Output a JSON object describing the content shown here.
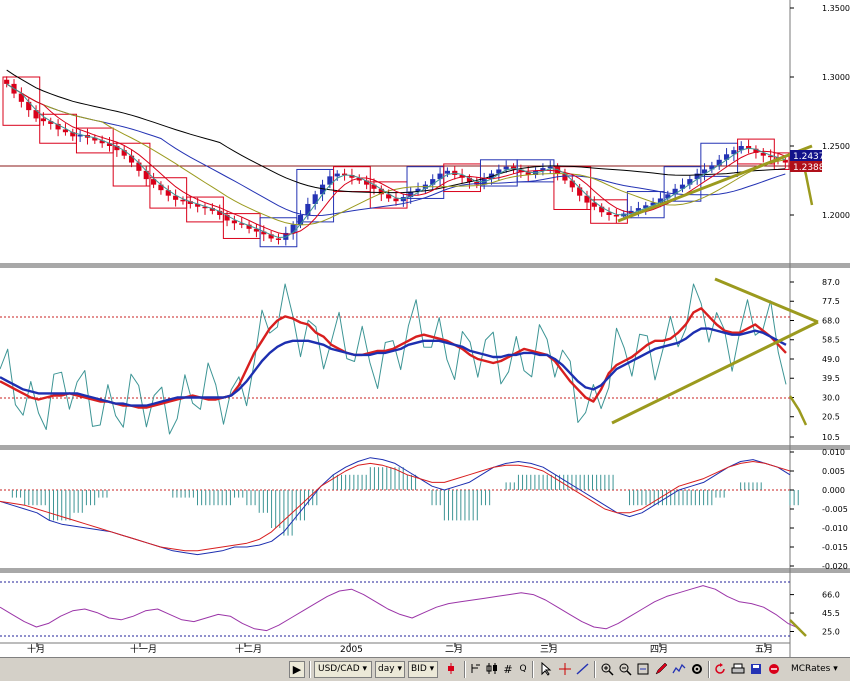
{
  "chart_data": [
    {
      "type": "candlestick",
      "title": "",
      "x_ticks": [
        "十月",
        "十一月",
        "十二月",
        "2005",
        "二月",
        "三月",
        "四月",
        "五月"
      ],
      "y_ticks": [
        "1.3500",
        "1.3000",
        "1.2500",
        "1.2000"
      ],
      "ylim": [
        1.16,
        1.35
      ],
      "price_labels": [
        "1.2437",
        "1.2388"
      ],
      "close_series": [
        1.295,
        1.288,
        1.282,
        1.276,
        1.27,
        1.268,
        1.266,
        1.262,
        1.26,
        1.257,
        1.258,
        1.256,
        1.254,
        1.252,
        1.25,
        1.247,
        1.243,
        1.238,
        1.232,
        1.226,
        1.222,
        1.218,
        1.214,
        1.211,
        1.21,
        1.208,
        1.206,
        1.205,
        1.203,
        1.2,
        1.196,
        1.194,
        1.193,
        1.19,
        1.188,
        1.186,
        1.183,
        1.182,
        1.187,
        1.193,
        1.2,
        1.208,
        1.215,
        1.222,
        1.228,
        1.23,
        1.229,
        1.227,
        1.225,
        1.222,
        1.219,
        1.215,
        1.212,
        1.21,
        1.213,
        1.217,
        1.219,
        1.222,
        1.226,
        1.23,
        1.232,
        1.229,
        1.227,
        1.224,
        1.222,
        1.226,
        1.23,
        1.233,
        1.235,
        1.233,
        1.231,
        1.229,
        1.232,
        1.234,
        1.235,
        1.23,
        1.225,
        1.22,
        1.214,
        1.209,
        1.206,
        1.202,
        1.2,
        1.199,
        1.201,
        1.203,
        1.205,
        1.207,
        1.209,
        1.212,
        1.215,
        1.219,
        1.222,
        1.226,
        1.23,
        1.233,
        1.236,
        1.24,
        1.244,
        1.247,
        1.25,
        1.248,
        1.245,
        1.243,
        1.242,
        1.24,
        1.238
      ],
      "moving_averages": 5,
      "horizontal_line": 1.237
    },
    {
      "type": "line",
      "y_ticks": [
        "87.0",
        "77.5",
        "68.0",
        "58.5",
        "49.0",
        "39.5",
        "30.0",
        "20.5",
        "10.5"
      ],
      "ylim": [
        10.5,
        87.0
      ],
      "reference_levels": [
        30,
        70
      ],
      "series": [
        {
          "values": [
            38,
            36,
            34,
            32,
            30,
            29,
            30,
            31,
            31,
            32,
            31,
            30,
            29,
            28,
            28,
            27,
            26,
            26,
            25,
            25,
            26,
            27,
            28,
            29,
            30,
            31,
            30,
            29,
            29,
            30,
            31,
            36,
            44,
            52,
            58,
            64,
            68,
            70,
            69,
            67,
            66,
            62,
            60,
            56,
            54,
            52,
            51,
            51,
            52,
            53,
            53,
            54,
            56,
            58,
            60,
            61,
            60,
            59,
            58,
            56,
            54,
            51,
            49,
            48,
            47,
            48,
            50,
            52,
            54,
            53,
            52,
            51,
            48,
            43,
            38,
            34,
            30,
            28,
            34,
            42,
            46,
            48,
            50,
            53,
            56,
            58,
            58,
            59,
            62,
            66,
            72,
            74,
            70,
            66,
            63,
            62,
            62,
            64,
            66,
            63,
            60,
            56,
            52
          ]
        },
        {
          "values": [
            40,
            38,
            36,
            34,
            33,
            32,
            32,
            32,
            32,
            32,
            32,
            31,
            30,
            29,
            28,
            27,
            27,
            26,
            26,
            26,
            27,
            28,
            29,
            30,
            30,
            30,
            30,
            30,
            30,
            30,
            31,
            34,
            38,
            43,
            48,
            52,
            55,
            57,
            58,
            58,
            58,
            57,
            56,
            54,
            53,
            52,
            51,
            51,
            51,
            52,
            52,
            53,
            54,
            56,
            57,
            58,
            58,
            58,
            57,
            56,
            55,
            53,
            52,
            51,
            50,
            50,
            51,
            51,
            52,
            52,
            51,
            51,
            49,
            46,
            42,
            38,
            35,
            34,
            36,
            40,
            44,
            46,
            48,
            50,
            52,
            54,
            55,
            56,
            57,
            59,
            62,
            64,
            64,
            63,
            62,
            61,
            61,
            62,
            63,
            62,
            60,
            58,
            56
          ]
        }
      ]
    },
    {
      "type": "line",
      "y_ticks": [
        "0.010",
        "0.005",
        "0.000",
        "-0.005",
        "-0.010",
        "-0.015",
        "-0.020"
      ],
      "ylim": [
        -0.02,
        0.01
      ],
      "series": [
        {
          "values": [
            -0.003,
            -0.004,
            -0.005,
            -0.006,
            -0.008,
            -0.009,
            -0.0095,
            -0.01,
            -0.0105,
            -0.011,
            -0.012,
            -0.013,
            -0.014,
            -0.015,
            -0.016,
            -0.0165,
            -0.017,
            -0.0165,
            -0.016,
            -0.015,
            -0.015,
            -0.0145,
            -0.0135,
            -0.011,
            -0.007,
            -0.003,
            0.001,
            0.004,
            0.006,
            0.0075,
            0.0085,
            0.008,
            0.007,
            0.005,
            0.003,
            0.001,
            0.0,
            0.001,
            0.002,
            0.004,
            0.006,
            0.007,
            0.0075,
            0.007,
            0.006,
            0.004,
            0.002,
            0.0,
            -0.002,
            -0.004,
            -0.006,
            -0.007,
            -0.006,
            -0.004,
            -0.002,
            0.0,
            0.001,
            0.002,
            0.004,
            0.006,
            0.0075,
            0.008,
            0.007,
            0.006,
            0.004
          ]
        },
        {
          "values": [
            -0.003,
            -0.0035,
            -0.004,
            -0.005,
            -0.006,
            -0.007,
            -0.008,
            -0.009,
            -0.01,
            -0.011,
            -0.012,
            -0.013,
            -0.014,
            -0.015,
            -0.0155,
            -0.016,
            -0.016,
            -0.0155,
            -0.015,
            -0.0145,
            -0.014,
            -0.013,
            -0.011,
            -0.008,
            -0.005,
            -0.002,
            0.001,
            0.003,
            0.005,
            0.0065,
            0.007,
            0.0065,
            0.0055,
            0.004,
            0.003,
            0.002,
            0.002,
            0.003,
            0.004,
            0.005,
            0.006,
            0.0065,
            0.0065,
            0.006,
            0.005,
            0.003,
            0.001,
            -0.001,
            -0.003,
            -0.005,
            -0.006,
            -0.006,
            -0.005,
            -0.003,
            -0.001,
            0.001,
            0.002,
            0.003,
            0.0045,
            0.006,
            0.007,
            0.0075,
            0.007,
            0.006,
            0.005
          ]
        }
      ]
    },
    {
      "type": "line",
      "y_ticks": [
        "66.0",
        "45.5",
        "25.0"
      ],
      "ylim": [
        20.0,
        80.0
      ],
      "reference_levels": [
        20,
        80
      ],
      "series": [
        {
          "values": [
            52,
            44,
            36,
            30,
            34,
            42,
            48,
            50,
            46,
            40,
            38,
            42,
            48,
            50,
            44,
            38,
            36,
            40,
            44,
            42,
            34,
            28,
            26,
            32,
            40,
            48,
            56,
            64,
            70,
            72,
            66,
            58,
            50,
            44,
            40,
            46,
            52,
            56,
            58,
            60,
            62,
            64,
            66,
            68,
            66,
            60,
            52,
            44,
            36,
            30,
            28,
            34,
            42,
            50,
            58,
            64,
            68,
            72,
            76,
            72,
            64,
            58,
            56,
            52,
            44,
            34,
            28
          ]
        }
      ]
    }
  ],
  "toolbar": {
    "symbol": "USD/CAD",
    "timeframe": "day",
    "price_side": "BID",
    "q_label": "Q",
    "dropdown_arrow": "▾",
    "next_glyph": "▶",
    "brand": "MCRates",
    "icons": [
      "scroll-next-icon",
      "candle-type-icon",
      "bars-icon",
      "grid-icon",
      "hash-icon",
      "cursor-icon",
      "crosshair-icon",
      "line-tool-icon",
      "zoom-in-icon",
      "zoom-out-icon",
      "zoom-fit-icon",
      "draw-icon",
      "indicator-icon",
      "settings-icon",
      "refresh-icon",
      "print-icon",
      "save-icon",
      "help-icon"
    ]
  },
  "colors": {
    "background": "#ffffff",
    "panel_bg": "#f5f5f5",
    "separator": "#a8a8a8",
    "bull_candle": "#2433b4",
    "bear_candle": "#d9001a",
    "trendline": "#9b9a1e",
    "stoch_k": "#3d9595",
    "stoch_slow": "#d81f1f",
    "stoch_signal": "#1d2fb0",
    "macd_line": "#1d2fb0",
    "macd_signal": "#d81f1f",
    "macd_hist": "#3d9595",
    "rsi": "#9b35a8",
    "price_tag_blue": "#12128a",
    "price_tag_red": "#b0101a"
  }
}
